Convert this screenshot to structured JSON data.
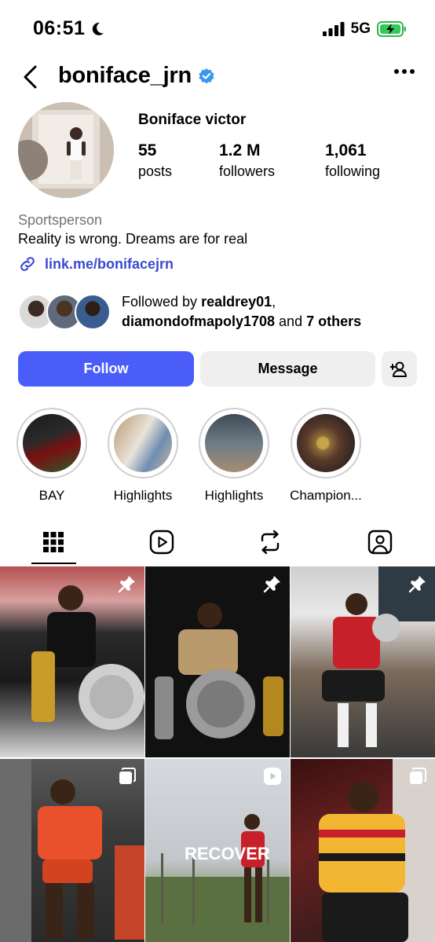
{
  "status_bar": {
    "time": "06:51",
    "network": "5G"
  },
  "header": {
    "username": "boniface_jrn"
  },
  "profile": {
    "display_name": "Boniface victor",
    "stats": [
      {
        "value": "55",
        "label": "posts"
      },
      {
        "value": "1.2 M",
        "label": "followers"
      },
      {
        "value": "1,061",
        "label": "following"
      }
    ],
    "category": "Sportsperson",
    "bio": "Reality is wrong. Dreams are for real",
    "link": "link.me/bonifacejrn",
    "followed_by": {
      "prefix": "Followed by ",
      "user1": "realdrey01",
      "sep": ",",
      "user2": "diamondofmapoly1708",
      "and": " and ",
      "others": "7 others"
    }
  },
  "actions": {
    "follow": "Follow",
    "message": "Message"
  },
  "highlights": [
    {
      "label": "BAY"
    },
    {
      "label": "Highlights"
    },
    {
      "label": "Highlights"
    },
    {
      "label": "Champion..."
    }
  ],
  "tabs": [
    "grid-icon",
    "reels-icon",
    "reposts-icon",
    "tagged-icon"
  ],
  "posts": [
    {
      "badge": "pin-icon"
    },
    {
      "badge": "pin-icon"
    },
    {
      "badge": "pin-icon"
    },
    {
      "badge": "carousel-icon"
    },
    {
      "badge": "reel-icon",
      "overlay_text": "RECOVER"
    },
    {
      "badge": "carousel-icon"
    }
  ],
  "colors": {
    "primary": "#4a5df9",
    "link": "#3a4ad1",
    "verified": "#3897f0"
  }
}
